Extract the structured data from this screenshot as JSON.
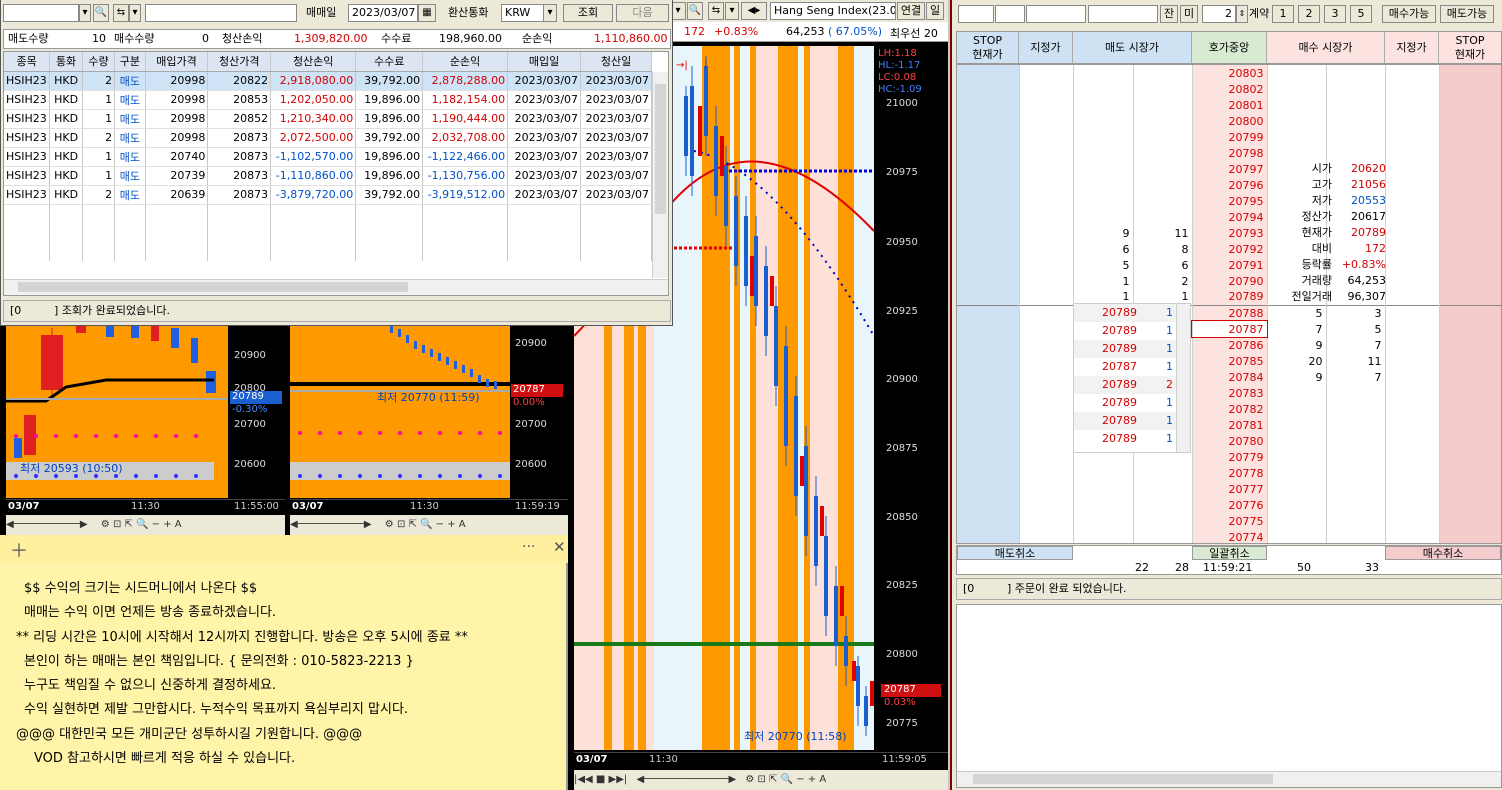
{
  "trade_window": {
    "date_label": "매매일",
    "date_value": "2023/03/07",
    "currency_label": "환산통화",
    "currency_value": "KRW",
    "search_btn": "조회",
    "next_btn": "다음",
    "summary": {
      "sell_qty_label": "매도수량",
      "sell_qty": "10",
      "buy_qty_label": "매수수량",
      "buy_qty": "0",
      "pnl_label": "청산손익",
      "pnl": "1,309,820.00",
      "fee_label": "수수료",
      "fee": "198,960.00",
      "net_label": "순손익",
      "net": "1,110,860.00"
    },
    "headers": [
      "종목",
      "통화",
      "수량",
      "구분",
      "매입가격",
      "청산가격",
      "청산손익",
      "수수료",
      "순손익",
      "매입일",
      "청산일"
    ],
    "rows": [
      [
        "HSIH23",
        "HKD",
        "2",
        "매도",
        "20998",
        "20822",
        "2,918,080.00",
        "39,792.00",
        "2,878,288.00",
        "2023/03/07",
        "2023/03/07"
      ],
      [
        "HSIH23",
        "HKD",
        "1",
        "매도",
        "20998",
        "20853",
        "1,202,050.00",
        "19,896.00",
        "1,182,154.00",
        "2023/03/07",
        "2023/03/07"
      ],
      [
        "HSIH23",
        "HKD",
        "1",
        "매도",
        "20998",
        "20852",
        "1,210,340.00",
        "19,896.00",
        "1,190,444.00",
        "2023/03/07",
        "2023/03/07"
      ],
      [
        "HSIH23",
        "HKD",
        "2",
        "매도",
        "20998",
        "20873",
        "2,072,500.00",
        "39,792.00",
        "2,032,708.00",
        "2023/03/07",
        "2023/03/07"
      ],
      [
        "HSIH23",
        "HKD",
        "1",
        "매도",
        "20740",
        "20873",
        "-1,102,570.00",
        "19,896.00",
        "-1,122,466.00",
        "2023/03/07",
        "2023/03/07"
      ],
      [
        "HSIH23",
        "HKD",
        "1",
        "매도",
        "20739",
        "20873",
        "-1,110,860.00",
        "19,896.00",
        "-1,130,756.00",
        "2023/03/07",
        "2023/03/07"
      ],
      [
        "HSIH23",
        "HKD",
        "2",
        "매도",
        "20639",
        "20873",
        "-3,879,720.00",
        "39,792.00",
        "-3,919,512.00",
        "2023/03/07",
        "2023/03/07"
      ]
    ],
    "status_code": "[0",
    "status_msg": "] 조회가 완료되었습니다."
  },
  "mid_toolbar": {
    "index_name": "Hang Seng Index(23.0",
    "link_btn": "연결",
    "day_btn": "일",
    "change": "172",
    "change_pct": "+0.83%",
    "volume": "64,253",
    "ratio": "( 67.05%)",
    "right_text": "최우선 20"
  },
  "main_chart": {
    "legend": [
      "LH:1.18",
      "HL:-1.17",
      "LC:0.08",
      "HC:-1.09"
    ],
    "y_ticks": [
      "21000",
      "20975",
      "20950",
      "20925",
      "20900",
      "20875",
      "20850",
      "20825",
      "20800",
      "20775"
    ],
    "current_price": "20787",
    "current_pct": "0.03%",
    "low_note": "최저 20770 (11:58)",
    "x_date": "03/07",
    "x_time": "11:30",
    "time_now": "11:59:05"
  },
  "small_chart_1": {
    "y_ticks": [
      "20900",
      "20800",
      "20700",
      "20600"
    ],
    "price": "20789",
    "pct": "-0.30%",
    "low_note": "최저 20593 (10:50)",
    "x_date": "03/07",
    "x_time": "11:30",
    "time_now": "11:55:00"
  },
  "small_chart_2": {
    "y_ticks": [
      "20900",
      "20800",
      "20700",
      "20600"
    ],
    "price": "20787",
    "pct": "0.00%",
    "low_note": "최저 20770 (11:59)",
    "x_date": "03/07",
    "x_time": "11:30",
    "time_now": "11:59:19"
  },
  "memo": {
    "lines": [
      "$$ 수익의 크기는 시드머니에서 나온다 $$",
      "매매는 수익 이면 언제든 방송 종료하겠습니다.",
      "** 리딩 시간은 10시에 시작해서 12시까지 진행합니다. 방송은 오후 5시에 종료 **",
      "본인이 하는 매매는 본인 책임입니다.        { 문의전화 : 010-5823-2213 }",
      "누구도 책임질 수 없으니 신중하게 결정하세요.",
      "수익 실현하면 제발 그만합시다. 누적수익 목표까지 욕심부리지 맙시다.",
      "@@@ 대한민국 모든 개미군단 성투하시길 기원합니다. @@@",
      "VOD 참고하시면 빠르게 적응 하실 수 있습니다."
    ]
  },
  "order_window": {
    "janmi_btn1": "잔",
    "janmi_btn2": "미",
    "qty": "2",
    "contract_label": "계약",
    "qty_btns": [
      "1",
      "2",
      "3",
      "5"
    ],
    "buy_avail": "매수가능",
    "sell_avail": "매도가능",
    "headers": {
      "stop_left": "STOP",
      "stop_left_sub": "현재가",
      "limit_left": "지정가",
      "sell_market": "매도 시장가",
      "center": "호가중앙",
      "buy_market": "매수 시장가",
      "limit_right": "지정가",
      "stop_right": "STOP",
      "stop_right_sub": "현재가"
    },
    "prices": [
      "20803",
      "20802",
      "20801",
      "20800",
      "20799",
      "20798",
      "20797",
      "20796",
      "20795",
      "20794",
      "20793",
      "20792",
      "20791",
      "20790",
      "20789",
      "20788",
      "20787",
      "20786",
      "20785",
      "20784",
      "20783",
      "20782",
      "20781",
      "20780",
      "20779",
      "20778",
      "20777",
      "20776",
      "20775",
      "20774"
    ],
    "ask_qty": [
      "",
      "",
      "",
      "",
      "",
      "",
      "",
      "",
      "",
      "",
      "9",
      "6",
      "5",
      "1",
      "1",
      "",
      "",
      "",
      "",
      "",
      "",
      "",
      "",
      "",
      "",
      "",
      "",
      "",
      "",
      ""
    ],
    "ask_cnt": [
      "",
      "",
      "",
      "",
      "",
      "",
      "",
      "",
      "",
      "",
      "11",
      "8",
      "6",
      "2",
      "1",
      "",
      "",
      "",
      "",
      "",
      "",
      "",
      "",
      "",
      "",
      "",
      "",
      "",
      "",
      ""
    ],
    "bid_qty": [
      "",
      "",
      "",
      "",
      "",
      "",
      "",
      "",
      "",
      "",
      "",
      "",
      "",
      "",
      "",
      "5",
      "7",
      "9",
      "20",
      "9",
      "",
      "",
      "",
      "",
      "",
      "",
      "",
      "",
      "",
      ""
    ],
    "bid_cnt": [
      "",
      "",
      "",
      "",
      "",
      "",
      "",
      "",
      "",
      "",
      "",
      "",
      "",
      "",
      "",
      "3",
      "5",
      "7",
      "11",
      "7",
      "",
      "",
      "",
      "",
      "",
      "",
      "",
      "",
      "",
      ""
    ],
    "info_labels": [
      "시가",
      "고가",
      "저가",
      "정산가",
      "현재가",
      "대비",
      "등락률",
      "거래량",
      "전일거래"
    ],
    "info_values": [
      "20620",
      "21056",
      "20553",
      "20617",
      "20789",
      "172",
      "+0.83%",
      "64,253",
      "96,307"
    ],
    "ticks": [
      [
        "20789",
        "1"
      ],
      [
        "20789",
        "1"
      ],
      [
        "20789",
        "1"
      ],
      [
        "20787",
        "1"
      ],
      [
        "20789",
        "2"
      ],
      [
        "20789",
        "1"
      ],
      [
        "20789",
        "1"
      ],
      [
        "20789",
        "1"
      ]
    ],
    "footer": {
      "sell_cancel": "매도취소",
      "ask_total_qty": "22",
      "ask_total_cnt": "28",
      "bulk_cancel": "일괄취소",
      "time": "11:59:21",
      "bid_total_qty": "50",
      "bid_total_cnt": "33",
      "buy_cancel": "매수취소"
    },
    "status_code": "[0",
    "status_msg": "] 주문이 완료 되었습니다."
  },
  "colors": {
    "up": "#d40000",
    "down": "#0050c8",
    "orange": "#ff9900"
  }
}
